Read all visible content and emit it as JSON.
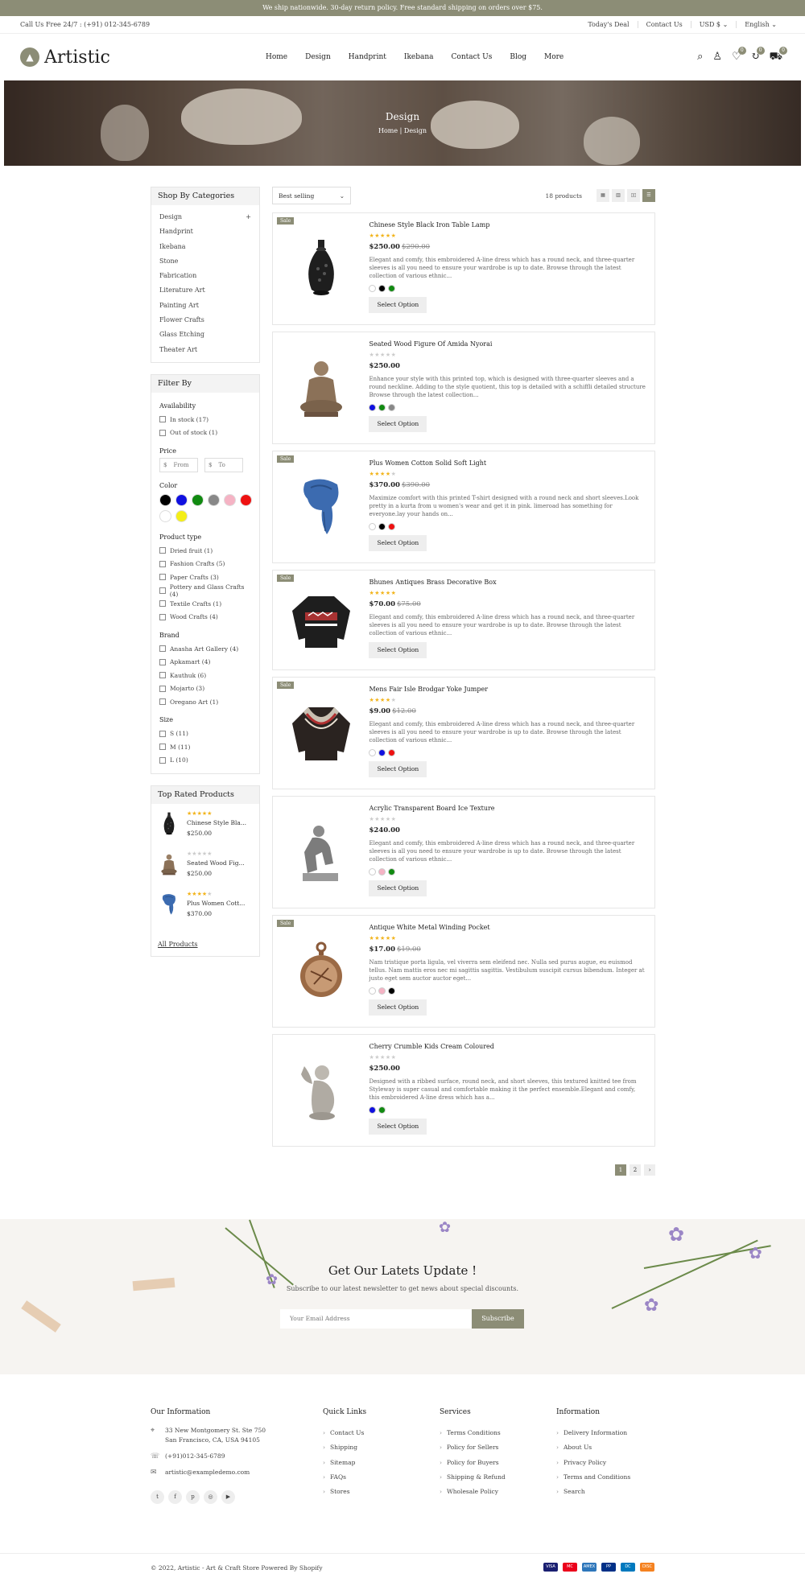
{
  "topbar": {
    "text": "We ship nationwide. 30-day return policy. Free standard shipping on orders over $75."
  },
  "infobar": {
    "call": "Call Us Free 24/7 : (+91) 012-345-6789",
    "links": [
      "Today's Deal",
      "Contact Us",
      "USD $ ⌄",
      "English ⌄"
    ]
  },
  "header": {
    "logo": "Artistic",
    "nav": [
      "Home",
      "Design",
      "Handprint",
      "Ikebana",
      "Contact Us",
      "Blog",
      "More"
    ],
    "wishlist_count": "0",
    "compare_count": "0",
    "cart_count": "0"
  },
  "banner": {
    "title": "Design",
    "crumb_home": "Home |",
    "crumb_current": "Design"
  },
  "sidebar": {
    "categories_title": "Shop By Categories",
    "categories": [
      "Design",
      "Handprint",
      "Ikebana",
      "Stone",
      "Fabrication",
      "Literature Art",
      "Painting Art",
      "Flower Crafts",
      "Glass Etching",
      "Theater Art"
    ],
    "category_plus": "+",
    "filter_title": "Filter By",
    "availability_label": "Availability",
    "availability": [
      "In stock (17)",
      "Out of stock (1)"
    ],
    "price_label": "Price",
    "price_from": "From",
    "price_to": "To",
    "currency": "$",
    "color_label": "Color",
    "colors": [
      "#000000",
      "#1010e0",
      "#118a11",
      "#888888",
      "#f5b3c4",
      "#ee1111",
      "#ffffff",
      "#f4ee17"
    ],
    "product_type_label": "Product type",
    "product_types": [
      "Dried fruit (1)",
      "Fashion Crafts (5)",
      "Paper Crafts (3)",
      "Pottery and Glass Crafts (4)",
      "Textile Crafts (1)",
      "Wood Crafts (4)"
    ],
    "brand_label": "Brand",
    "brands": [
      "Anasha Art Gallery (4)",
      "Apkamart (4)",
      "Kauthuk (6)",
      "Mojarto (3)",
      "Oregano Art (1)"
    ],
    "size_label": "Size",
    "sizes": [
      "S (11)",
      "M (11)",
      "L (10)"
    ],
    "top_rated_title": "Top Rated Products",
    "top_rated": [
      {
        "name": "Chinese Style Bla...",
        "price": "$250.00",
        "rating": 5
      },
      {
        "name": "Seated Wood Fig...",
        "price": "$250.00",
        "rating": 0
      },
      {
        "name": "Plus Women Cott...",
        "price": "$370.00",
        "rating": 4
      }
    ],
    "all_products": "All Products"
  },
  "toolbar": {
    "sort": "Best selling",
    "count": "18 products"
  },
  "products": [
    {
      "sale": "Sale",
      "title": "Chinese Style Black Iron Table Lamp",
      "rating": 5,
      "price": "$250.00",
      "old_price": "$290.00",
      "desc": "Elegant and comfy, this embroidered A-line dress which has a round neck, and three-quarter sleeves is all you need to ensure your wardrobe is up to date. Browse through the latest collection of various ethnic...",
      "swatches": [
        "#ffffff",
        "#000000",
        "#118a11"
      ],
      "button": "Select Option",
      "img": "vase"
    },
    {
      "sale": "",
      "title": "Seated Wood Figure Of Amida Nyorai",
      "rating": 0,
      "price": "$250.00",
      "old_price": "",
      "desc": "Enhance your style with this printed top, which is designed with three-quarter sleeves and a round neckline. Adding to the style quotient, this top is detailed with a schiffli detailed structure Browse through the latest collection...",
      "swatches": [
        "#1010e0",
        "#118a11",
        "#888888"
      ],
      "button": "Select Option",
      "img": "buddha"
    },
    {
      "sale": "Sale",
      "title": "Plus Women Cotton Solid Soft Light",
      "rating": 4,
      "price": "$370.00",
      "old_price": "$390.00",
      "desc": "Maximize comfort with this printed T-shirt designed with a round neck and short sleeves.Look pretty in a kurta from u women's wear and get it in pink. limeroad has something for everyone.lay your hands on...",
      "swatches": [
        "#ffffff",
        "#000000",
        "#ee1111"
      ],
      "button": "Select Option",
      "img": "scarf"
    },
    {
      "sale": "Sale",
      "title": "Bhunes Antiques Brass Decorative Box",
      "rating": 5,
      "price": "$70.00",
      "old_price": "$75.00",
      "desc": "Elegant and comfy, this embroidered A-line dress which has a round neck, and three-quarter sleeves is all you need to ensure your wardrobe is up to date. Browse through the latest collection of various ethnic...",
      "swatches": [],
      "button": "Select Option",
      "img": "sweater1"
    },
    {
      "sale": "Sale",
      "title": "Mens Fair Isle Brodgar Yoke Jumper",
      "rating": 4,
      "price": "$9.00",
      "old_price": "$12.00",
      "desc": "Elegant and comfy, this embroidered A-line dress which has a round neck, and three-quarter sleeves is all you need to ensure your wardrobe is up to date. Browse through the latest collection of various ethnic...",
      "swatches": [
        "#ffffff",
        "#1010e0",
        "#ee1111"
      ],
      "button": "Select Option",
      "img": "sweater2"
    },
    {
      "sale": "",
      "title": "Acrylic Transparent Board Ice Texture",
      "rating": 0,
      "price": "$240.00",
      "old_price": "",
      "desc": "Elegant and comfy, this embroidered A-line dress which has a round neck, and three-quarter sleeves is all you need to ensure your wardrobe is up to date. Browse through the latest collection of various ethnic...",
      "swatches": [
        "#ffffff",
        "#f5b3c4",
        "#118a11"
      ],
      "button": "Select Option",
      "img": "thinker"
    },
    {
      "sale": "Sale",
      "title": "Antique White Metal Winding Pocket",
      "rating": 5,
      "price": "$17.00",
      "old_price": "$19.00",
      "desc": "Nam tristique porta ligula, vel viverra sem eleifend nec. Nulla sed purus augue, eu euismod tellus. Nam mattis eros nec mi sagittis sagittis. Vestibulum suscipit cursus bibendum. Integer at justo eget sem auctor auctor eget...",
      "swatches": [
        "#ffffff",
        "#f5b3c4",
        "#000000"
      ],
      "button": "Select Option",
      "img": "watch"
    },
    {
      "sale": "",
      "title": "Cherry Crumble Kids Cream Coloured",
      "rating": 0,
      "price": "$250.00",
      "old_price": "",
      "desc": "Designed with a ribbed surface, round neck, and short sleeves, this textured knitted tee from Styleway is super casual and comfortable making it the perfect ensemble.Elegant and comfy, this embroidered A-line dress which has a...",
      "swatches": [
        "#1010e0",
        "#118a11"
      ],
      "button": "Select Option",
      "img": "cherub"
    }
  ],
  "pager": [
    "1",
    "2",
    "›"
  ],
  "newsletter": {
    "title": "Get Our Latets Update !",
    "subtitle": "Subscribe to our latest newsletter to get news about special discounts.",
    "placeholder": "Your Email Address",
    "button": "Subscribe"
  },
  "footer": {
    "info_title": "Our Information",
    "address": "33 New Montgomery St. Ste 750 San Francisco, CA, USA 94105",
    "phone": "(+91)012-345-6789",
    "email": "artistic@exampledemo.com",
    "socials": [
      "t",
      "f",
      "p",
      "◎",
      "▶"
    ],
    "quick_title": "Quick Links",
    "quick": [
      "Contact Us",
      "Shipping",
      "Sitemap",
      "FAQs",
      "Stores"
    ],
    "services_title": "Services",
    "services": [
      "Terms Conditions",
      "Policy for Sellers",
      "Policy for Buyers",
      "Shipping & Refund",
      "Wholesale Policy"
    ],
    "information_title": "Information",
    "information": [
      "Delivery Information",
      "About Us",
      "Privacy Policy",
      "Terms and Conditions",
      "Search"
    ]
  },
  "bottom": {
    "copyright": "© 2022, Artistic - Art & Craft Store Powered By Shopify",
    "payments": [
      "VISA",
      "MC",
      "AMEX",
      "PP",
      "DC",
      "DISC"
    ]
  }
}
